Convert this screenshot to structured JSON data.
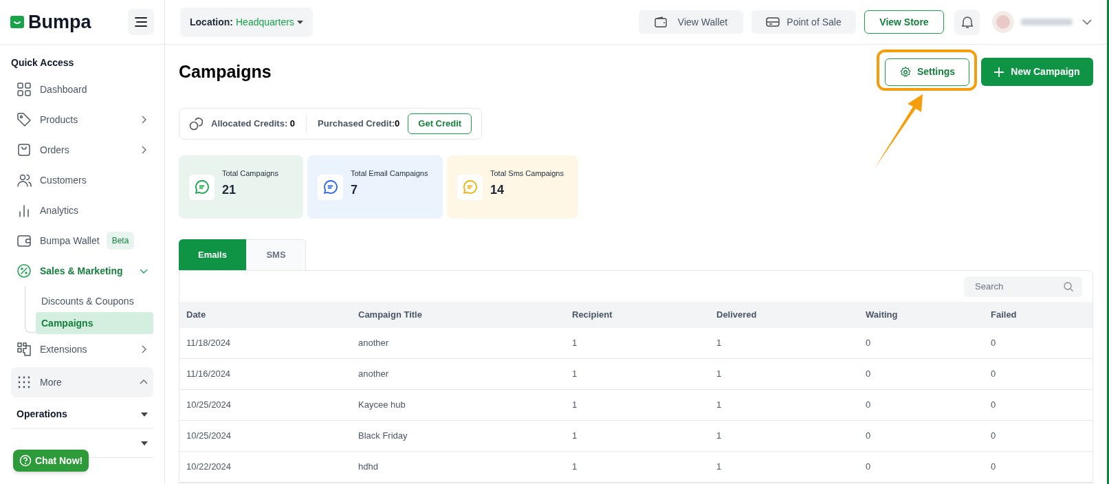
{
  "brand": {
    "name": "Bumpa"
  },
  "sidebar": {
    "heading": "Quick Access",
    "items": [
      {
        "label": "Dashboard",
        "kind": "link",
        "selected": false
      },
      {
        "label": "Products",
        "kind": "menu",
        "expanded": false,
        "selected": false
      },
      {
        "label": "Orders",
        "kind": "menu",
        "expanded": false,
        "selected": false
      },
      {
        "label": "Customers",
        "kind": "link",
        "selected": false
      },
      {
        "label": "Analytics",
        "kind": "link",
        "selected": false
      },
      {
        "label": "Bumpa Wallet",
        "kind": "link",
        "badge": "Beta",
        "selected": false
      },
      {
        "label": "Sales & Marketing",
        "kind": "menu",
        "expanded": true,
        "selected": true,
        "children": [
          {
            "label": "Discounts & Coupons",
            "selected": false
          },
          {
            "label": "Campaigns",
            "selected": true
          }
        ]
      },
      {
        "label": "Extensions",
        "kind": "menu",
        "expanded": false,
        "selected": false
      },
      {
        "label": "More",
        "kind": "section",
        "expanded": true,
        "selected": false
      }
    ],
    "groups": [
      {
        "label": "Operations",
        "expanded": false
      },
      {
        "expanded": false
      }
    ]
  },
  "chat_button": {
    "label": "Chat Now!"
  },
  "header": {
    "location_label": "Location:",
    "location_value": "Headquarters",
    "buttons": [
      {
        "label": "View Wallet",
        "kind": "wallet"
      },
      {
        "label": "Point of Sale",
        "kind": "pos"
      },
      {
        "label": "View Store",
        "kind": "outline"
      }
    ]
  },
  "page": {
    "title": "Campaigns",
    "settings_button": "Settings",
    "new_button": "New Campaign",
    "credits": [
      {
        "label": "Allocated Credits:",
        "value": "0"
      },
      {
        "label": "Purchased Credit:",
        "value": "0"
      }
    ],
    "get_credit": "Get Credit",
    "stats": [
      {
        "label": "Total Campaigns",
        "value": "21",
        "color": "#16a34a"
      },
      {
        "label": "Total Email Campaigns",
        "value": "7",
        "color": "#2563eb"
      },
      {
        "label": "Total Sms Campaigns",
        "value": "14",
        "color": "#eab308"
      }
    ],
    "tabs": [
      {
        "label": "Emails",
        "selected": true
      },
      {
        "label": "SMS",
        "selected": false
      }
    ],
    "search": {
      "placeholder": "Search"
    },
    "table": {
      "columns": [
        "Date",
        "Campaign Title",
        "Recipient",
        "Delivered",
        "Waiting",
        "Failed"
      ],
      "rows": [
        [
          "11/18/2024",
          "another",
          "1",
          "1",
          "0",
          "0"
        ],
        [
          "11/16/2024",
          "another",
          "1",
          "1",
          "0",
          "0"
        ],
        [
          "10/25/2024",
          "Kaycee hub",
          "1",
          "1",
          "0",
          "0"
        ],
        [
          "10/25/2024",
          "Black Friday",
          "1",
          "1",
          "0",
          "0"
        ],
        [
          "10/22/2024",
          "hdhd",
          "1",
          "1",
          "0",
          "0"
        ]
      ]
    }
  }
}
